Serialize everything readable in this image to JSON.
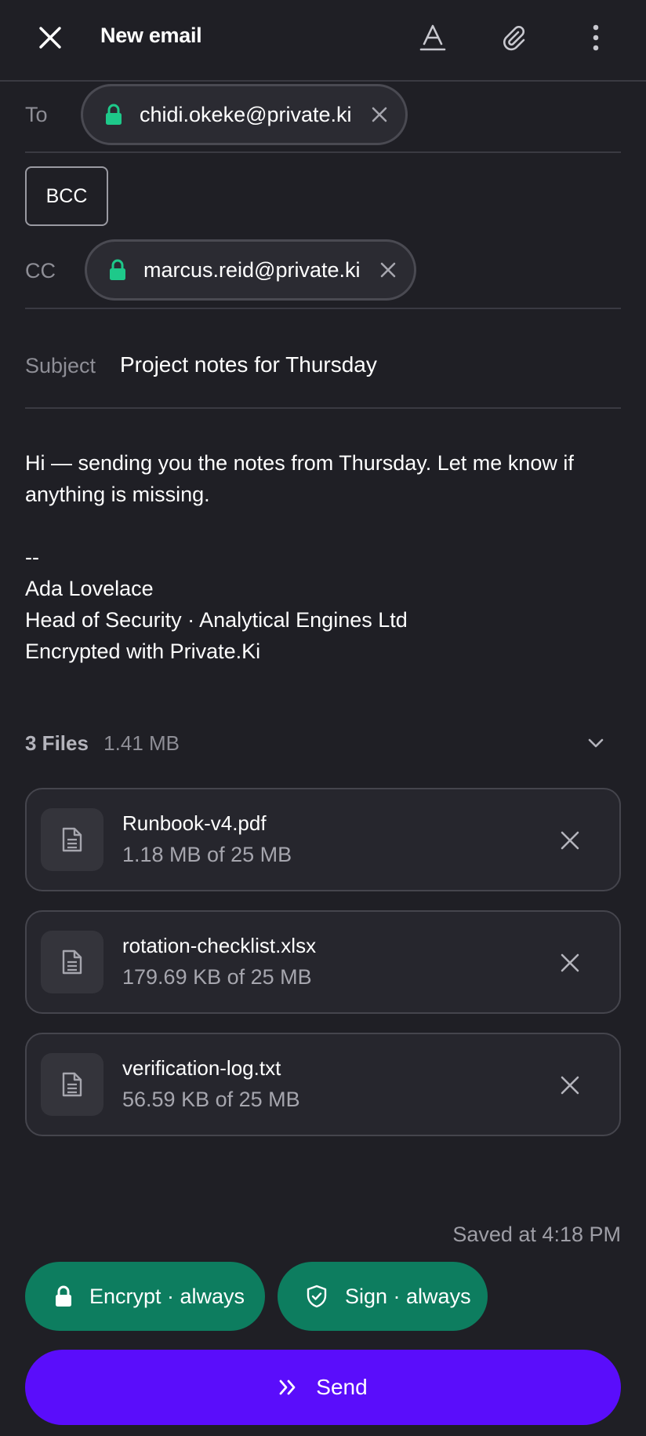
{
  "header": {
    "title": "New email",
    "close_icon": "close-icon",
    "format_icon": "text-format-icon",
    "attach_icon": "paperclip-icon",
    "more_icon": "more-vertical-icon"
  },
  "to": {
    "label": "To",
    "recipients": [
      {
        "address": "chidi.okeke@private.ki",
        "encrypted": true
      }
    ]
  },
  "bcc": {
    "label": "BCC"
  },
  "cc": {
    "label": "CC",
    "recipients": [
      {
        "address": "marcus.reid@private.ki",
        "encrypted": true
      }
    ]
  },
  "subject": {
    "label": "Subject",
    "value": "Project notes for Thursday"
  },
  "body": {
    "message": "Hi — sending you the notes from Thursday. Let me know if anything is missing.",
    "signature_separator": "--",
    "signature_name": "Ada Lovelace",
    "signature_title": "Head of Security · Analytical Engines Ltd",
    "signature_note": "Encrypted with Private.Ki"
  },
  "attachments": {
    "count_label": "3 Files",
    "total_size": "1.41 MB",
    "files": [
      {
        "name": "Runbook-v4.pdf",
        "size": "1.18 MB of 25 MB"
      },
      {
        "name": "rotation-checklist.xlsx",
        "size": "179.69 KB of 25 MB"
      },
      {
        "name": "verification-log.txt",
        "size": "56.59 KB of 25 MB"
      }
    ]
  },
  "footer": {
    "saved_status": "Saved at 4:18 PM",
    "encrypt_label": "Encrypt · always",
    "sign_label": "Sign · always",
    "send_label": "Send"
  },
  "colors": {
    "background": "#1f1f25",
    "accent_green": "#0d7d5f",
    "lock_green": "#1ec98a",
    "send_purple": "#5a0dfb"
  }
}
